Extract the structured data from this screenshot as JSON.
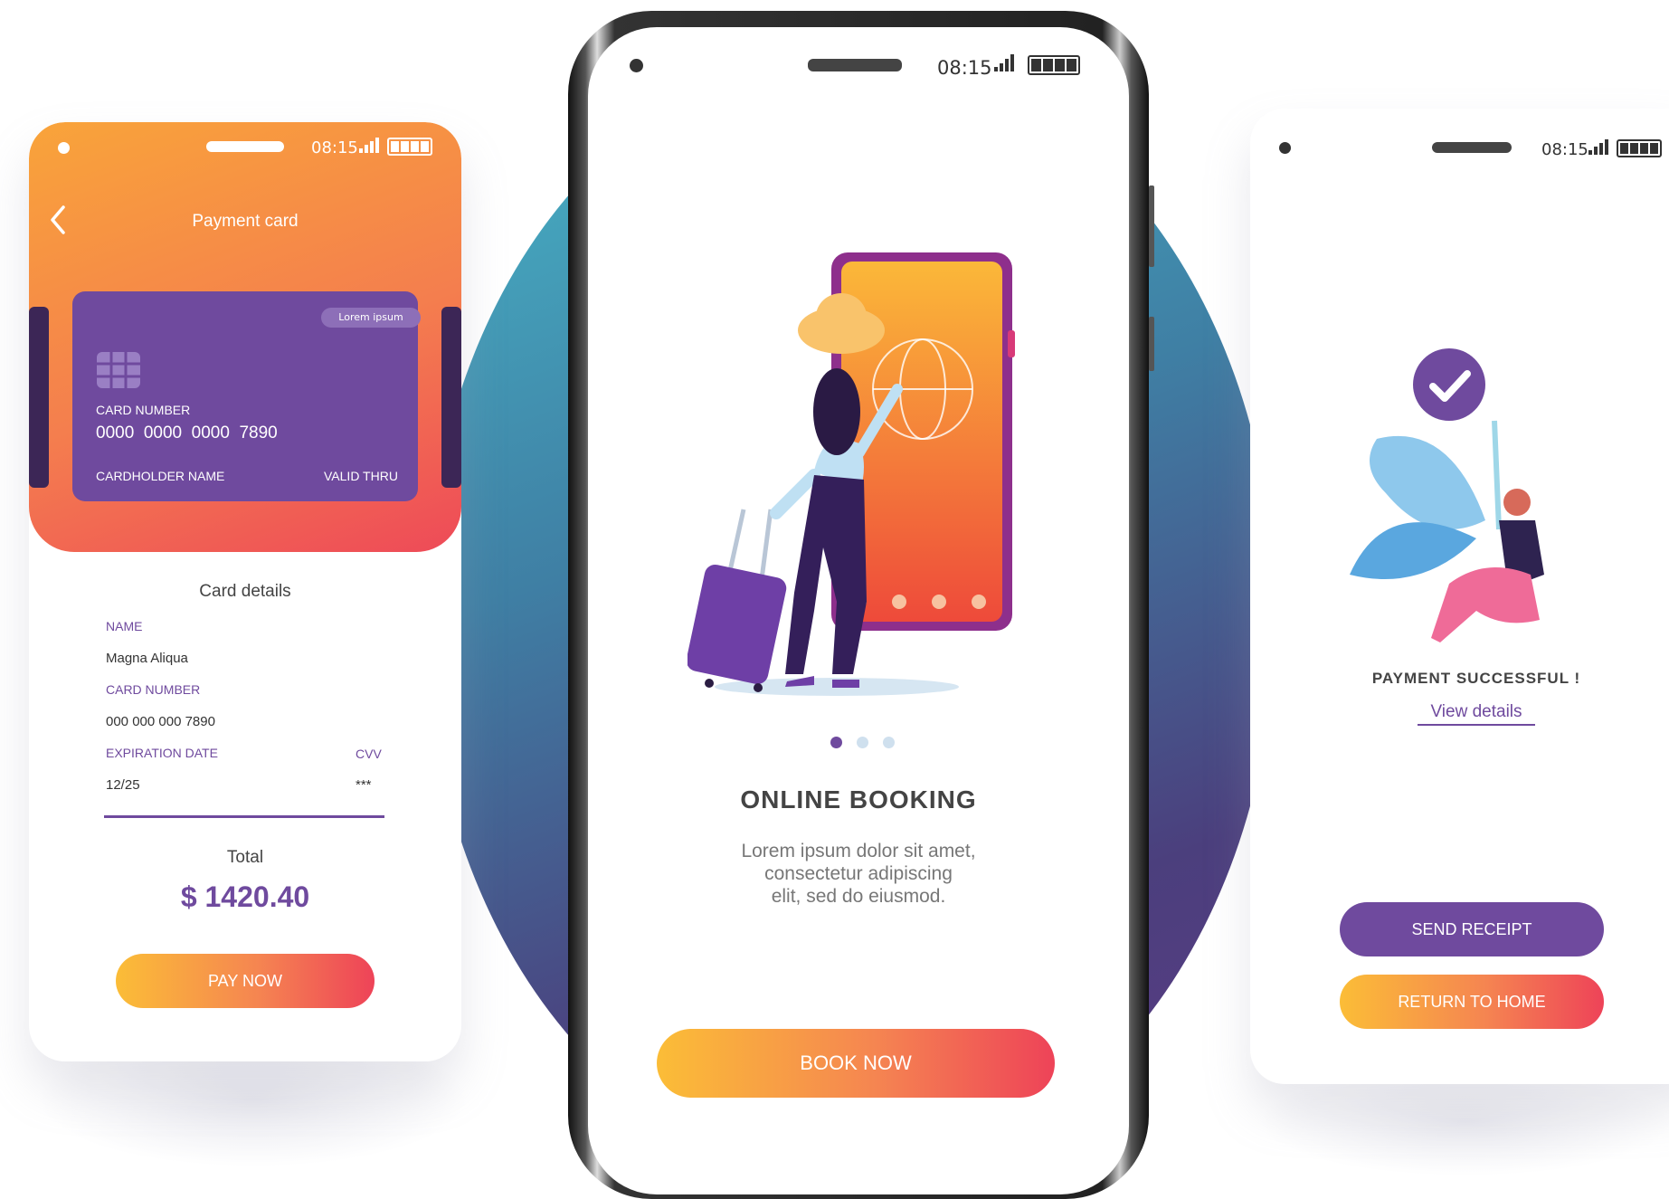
{
  "status_bar": {
    "time": "08:15"
  },
  "left_phone": {
    "title": "Payment card",
    "card": {
      "badge": "Lorem ipsum",
      "number_label": "CARD NUMBER",
      "number": "0000  0000  0000  7890",
      "holder_label": "CARDHOLDER NAME",
      "valid_label": "VALID THRU"
    },
    "details": {
      "heading": "Card details",
      "name_label": "NAME",
      "name_value": "Magna Aliqua",
      "card_number_label": "CARD NUMBER",
      "card_number_value": "000 000 000 7890",
      "expiration_label": "EXPIRATION DATE",
      "expiration_value": "12/25",
      "cvv_label": "CVV",
      "cvv_value": "***"
    },
    "total_label": "Total",
    "total_value": "$ 1420.40",
    "pay_button": "PAY NOW"
  },
  "center_phone": {
    "pagination": {
      "count": 3,
      "active": 0
    },
    "title": "ONLINE BOOKING",
    "description_lines": [
      "Lorem ipsum dolor sit amet,",
      "consectetur adipiscing",
      "elit, sed do eiusmod."
    ],
    "book_button": "BOOK NOW"
  },
  "right_phone": {
    "success_text": "PAYMENT SUCCESSFUL !",
    "details_link": "View details",
    "send_button": "SEND RECEIPT",
    "home_button": "RETURN TO HOME"
  },
  "colors": {
    "purple": "#6f4a9e",
    "gradient_start": "#fbbd37",
    "gradient_end": "#ee4358",
    "dark_text": "#444444"
  },
  "icons": [
    "back-chevron-icon",
    "signal-icon",
    "battery-icon",
    "card-chip-icon",
    "checkmark-icon"
  ]
}
